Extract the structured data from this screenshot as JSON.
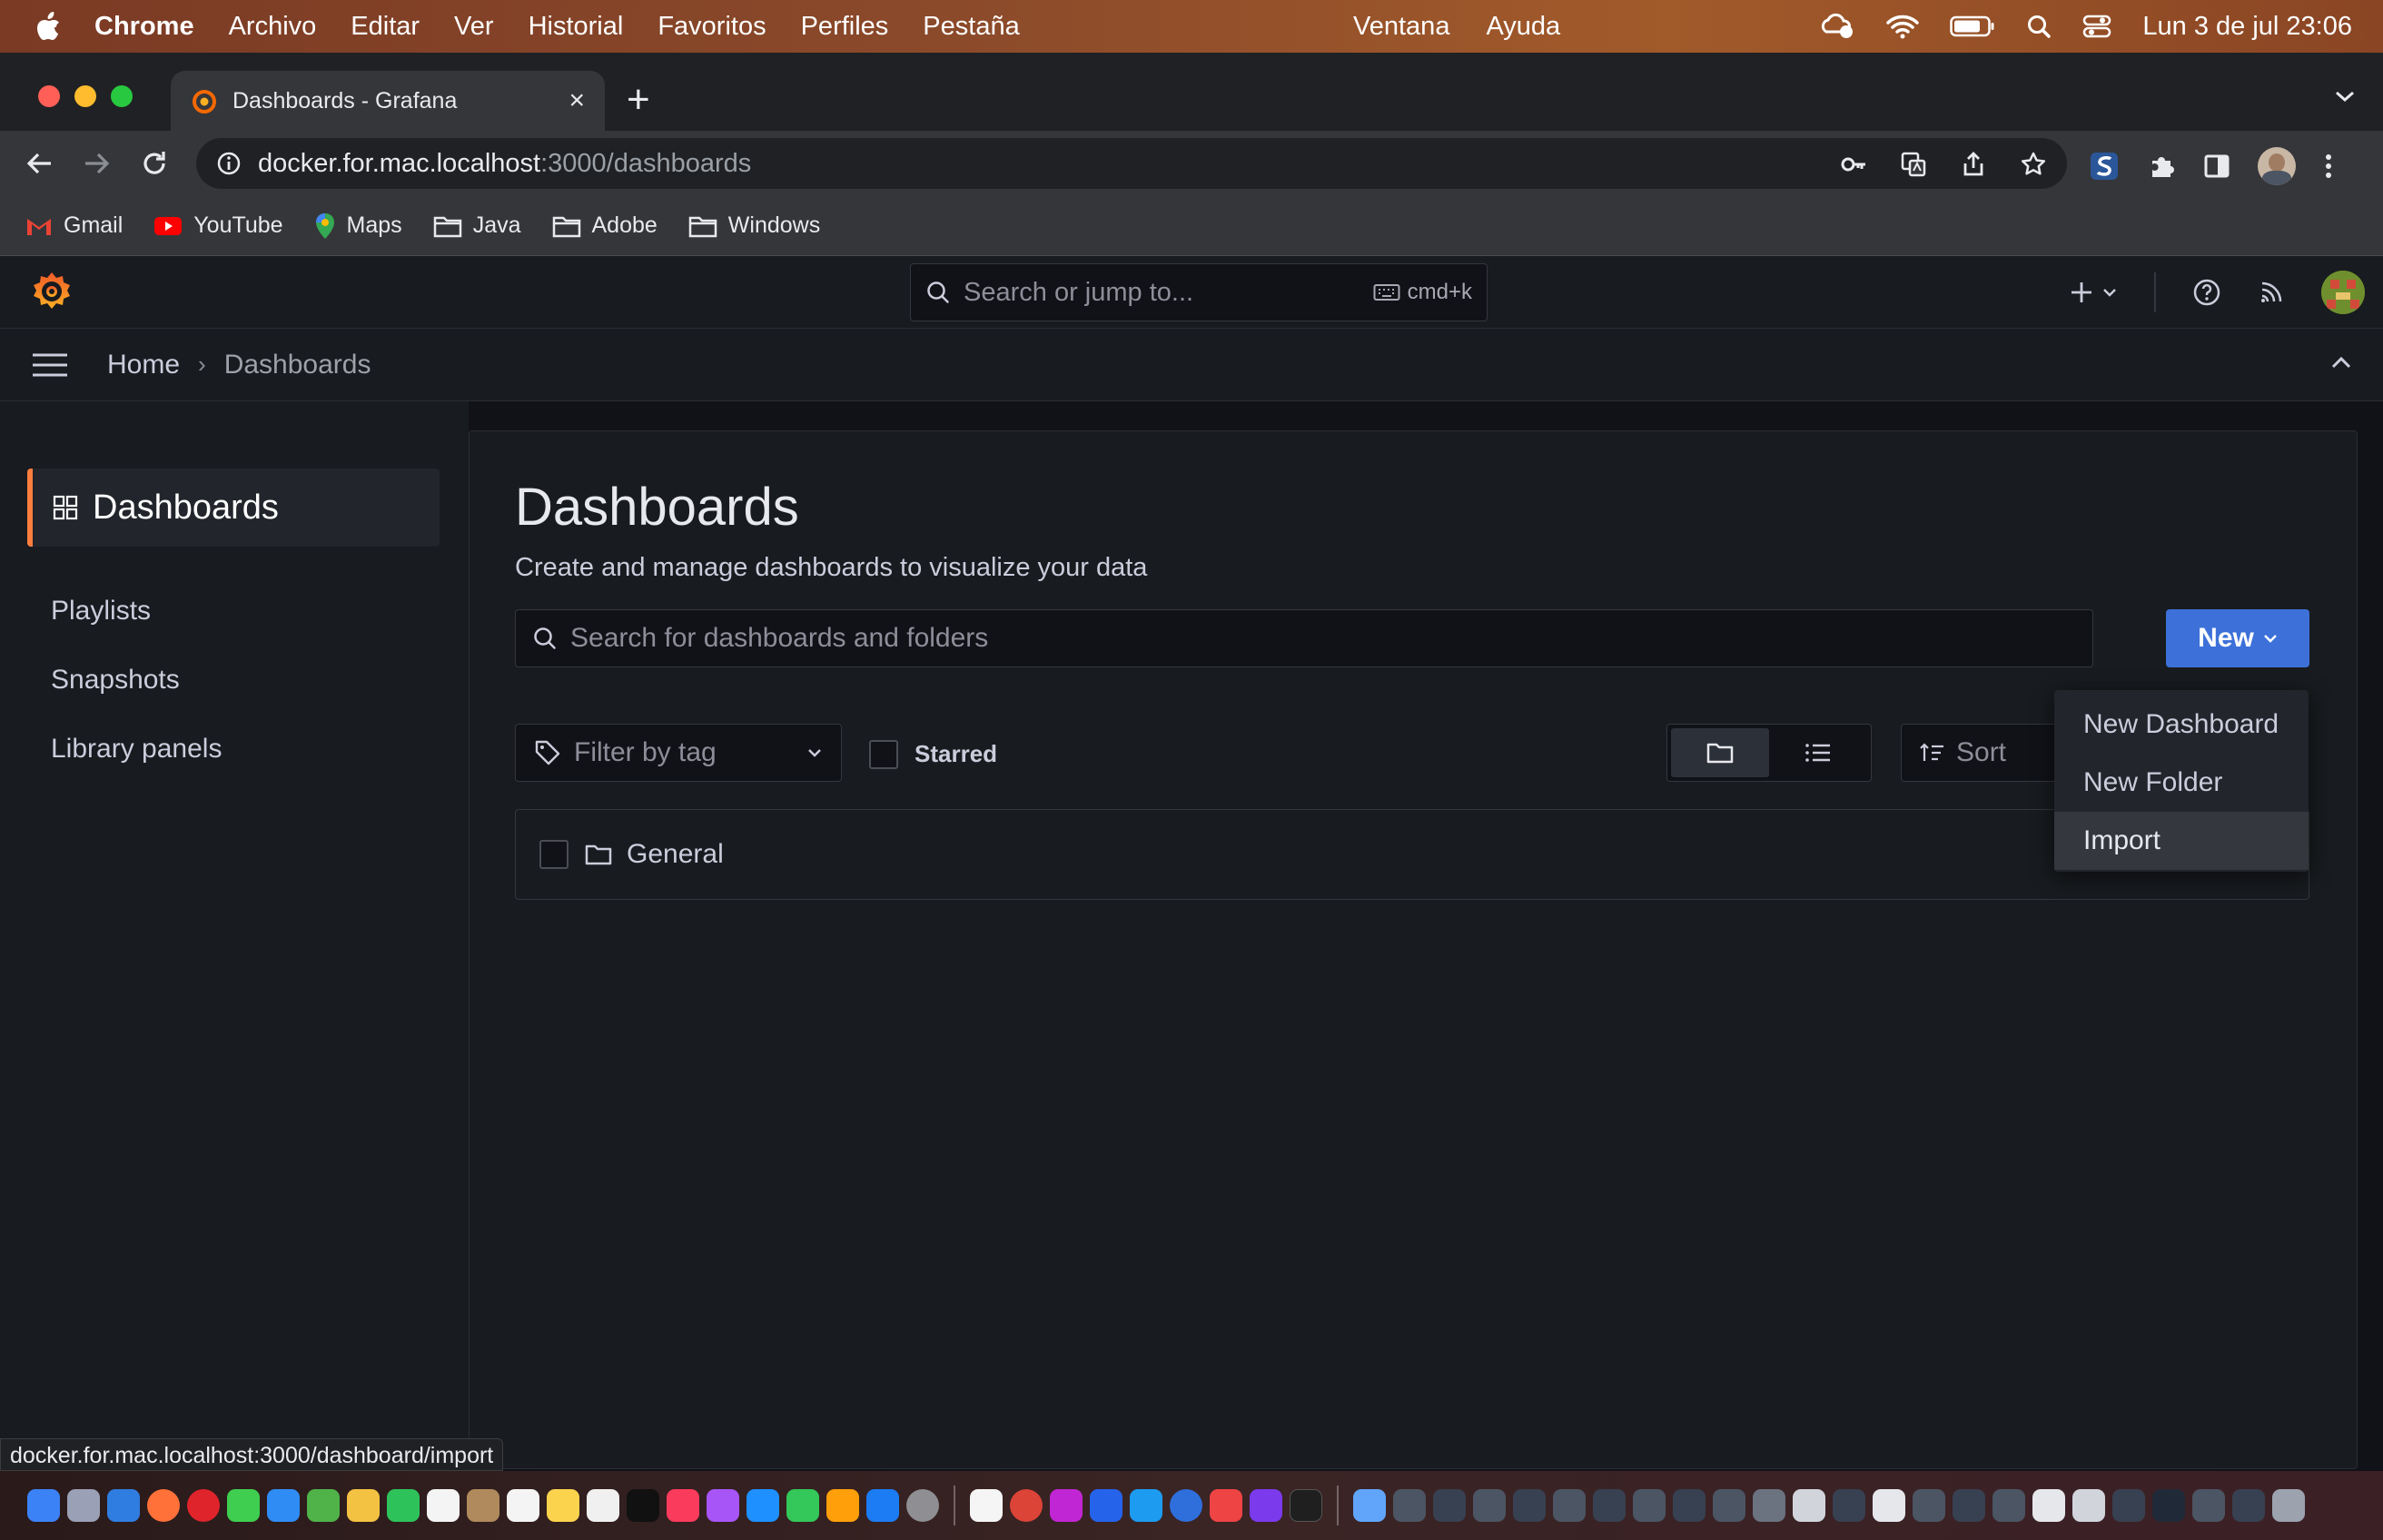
{
  "menubar": {
    "app_name": "Chrome",
    "menus": [
      "Archivo",
      "Editar",
      "Ver",
      "Historial",
      "Favoritos",
      "Perfiles",
      "Pestaña"
    ],
    "menus_right": [
      "Ventana",
      "Ayuda"
    ],
    "clock": "Lun 3 de jul  23:06"
  },
  "browser": {
    "tab_title": "Dashboards - Grafana",
    "url_host": "docker.for.mac.localhost",
    "url_rest": ":3000/dashboards",
    "bookmarks": [
      "Gmail",
      "YouTube",
      "Maps",
      "Java",
      "Adobe",
      "Windows"
    ],
    "status_url": "docker.for.mac.localhost:3000/dashboard/import"
  },
  "grafana": {
    "search_placeholder": "Search or jump to...",
    "search_shortcut": "cmd+k",
    "breadcrumb": {
      "home": "Home",
      "current": "Dashboards"
    },
    "sidenav": {
      "active": "Dashboards",
      "items": [
        "Playlists",
        "Snapshots",
        "Library panels"
      ]
    },
    "page": {
      "title": "Dashboards",
      "subtitle": "Create and manage dashboards to visualize your data",
      "search_placeholder": "Search for dashboards and folders",
      "new_button": "New",
      "filter_placeholder": "Filter by tag",
      "starred_label": "Starred",
      "sort_label": "Sort",
      "folders": [
        {
          "name": "General"
        }
      ]
    },
    "new_menu": {
      "items": [
        "New Dashboard",
        "New Folder",
        "Import"
      ],
      "highlighted": "Import"
    },
    "accent_color": "#ff7e3e",
    "primary_button_color": "#3d71d9"
  }
}
